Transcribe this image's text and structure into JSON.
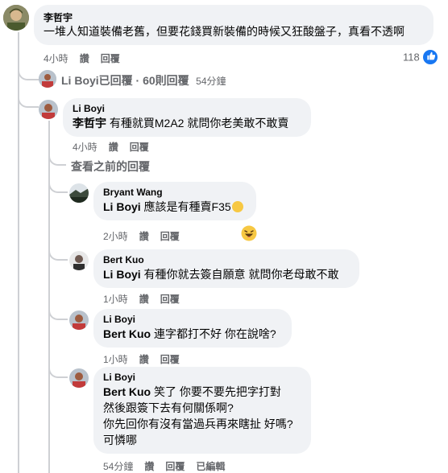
{
  "comments": {
    "top": {
      "author": "李哲宇",
      "text": "一堆人知道裝備老舊，但要花錢買新裝備的時候又狂酸盤子，真看不透啊",
      "time": "4小時",
      "action_like": "讚",
      "action_reply": "回覆",
      "reaction_count": "118"
    },
    "replies_summary": {
      "text": "Li Boyi已回覆 · 60則回覆",
      "time": "54分鐘"
    },
    "reply1": {
      "author": "Li Boyi",
      "mention": "李哲宇",
      "text": " 有種就買M2A2 就問你老美敢不敢賣",
      "time": "4小時",
      "action_like": "讚",
      "action_reply": "回覆"
    },
    "view_previous": "查看之前的回覆",
    "nested1": {
      "author": "Bryant Wang",
      "mention": "Li Boyi",
      "text": " 應該是有種賣F35",
      "time": "2小時",
      "action_like": "讚",
      "action_reply": "回覆"
    },
    "nested2": {
      "author": "Bert Kuo",
      "mention": "Li Boyi",
      "text": " 有種你就去簽自願意 就問你老母敢不敢",
      "time": "1小時",
      "action_like": "讚",
      "action_reply": "回覆"
    },
    "nested3": {
      "author": "Li Boyi",
      "mention": "Bert Kuo",
      "text": " 連字都打不好 你在說啥?",
      "time": "1小時",
      "action_like": "讚",
      "action_reply": "回覆"
    },
    "nested4": {
      "author": "Li Boyi",
      "mention": "Bert Kuo",
      "line1": " 笑了 你要不要先把字打對",
      "line2": "然後跟簽下去有何關係啊?",
      "line3": "你先回你有沒有當過兵再來瞎扯 好嗎?",
      "line4": "可憐哪",
      "time": "54分鐘",
      "action_like": "讚",
      "action_reply": "回覆",
      "edited": "已編輯"
    }
  },
  "colors": {
    "like_blue": "#1877f2",
    "bubble_bg": "#f0f2f5",
    "meta_gray": "#65676b",
    "thread_line": "#ced0d4"
  }
}
